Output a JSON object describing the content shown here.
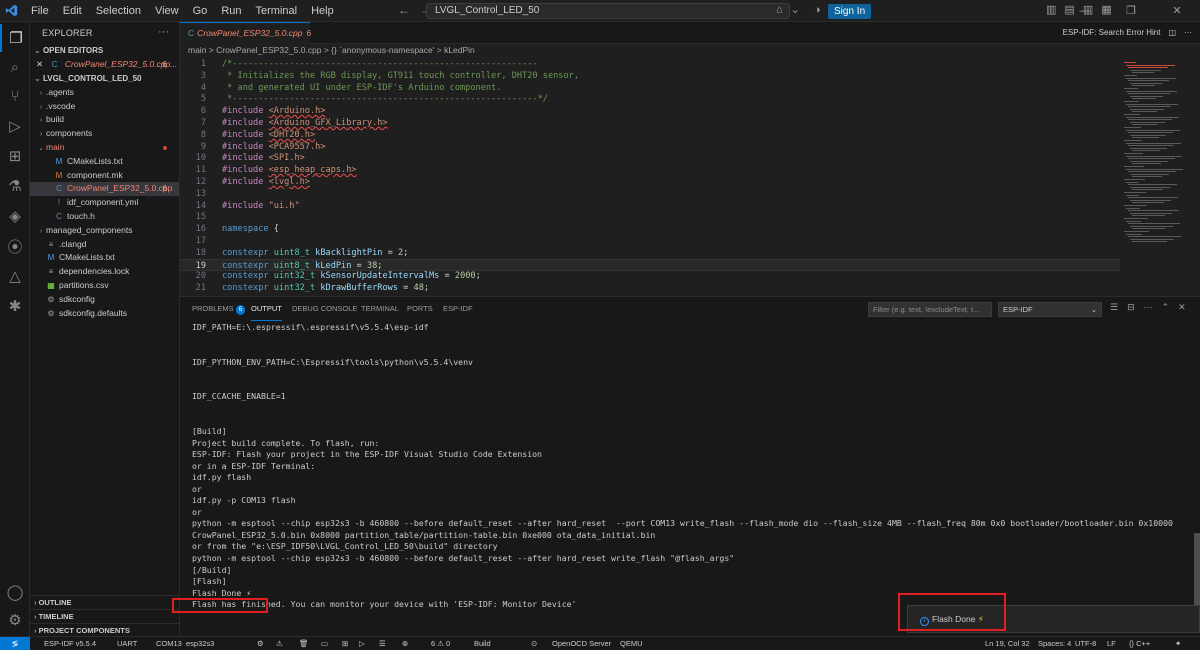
{
  "titlebar": {
    "menu": [
      "File",
      "Edit",
      "Selection",
      "View",
      "Go",
      "Run",
      "Terminal",
      "Help"
    ],
    "search": "LVGL_Control_LED_50",
    "sign_in": "Sign In"
  },
  "sidebar": {
    "title": "EXPLORER",
    "open_editors_label": "OPEN EDITORS",
    "open_editor_file": "CrowPanel_ESP32_5.0.cpp...",
    "open_editor_count": "6",
    "project_label": "LVGL_CONTROL_LED_50",
    "tree": [
      {
        "name": ".agents",
        "type": "folder"
      },
      {
        "name": ".vscode",
        "type": "folder"
      },
      {
        "name": "build",
        "type": "folder"
      },
      {
        "name": "components",
        "type": "folder"
      },
      {
        "name": "main",
        "type": "folder-open"
      },
      {
        "name": "CMakeLists.txt",
        "type": "cmake"
      },
      {
        "name": "component.mk",
        "type": "make"
      },
      {
        "name": "CrowPanel_ESP32_5.0.cpp",
        "type": "cpp",
        "count": "6"
      },
      {
        "name": "idf_component.yml",
        "type": "yml"
      },
      {
        "name": "touch.h",
        "type": "h"
      },
      {
        "name": "managed_components",
        "type": "folder"
      },
      {
        "name": ".clangd",
        "type": "file"
      },
      {
        "name": "CMakeLists.txt",
        "type": "cmake"
      },
      {
        "name": "dependencies.lock",
        "type": "file"
      },
      {
        "name": "partitions.csv",
        "type": "csv"
      },
      {
        "name": "sdkconfig",
        "type": "gear"
      },
      {
        "name": "sdkconfig.defaults",
        "type": "gear"
      }
    ],
    "bottom_sections": [
      "OUTLINE",
      "TIMELINE",
      "PROJECT COMPONENTS"
    ]
  },
  "editor": {
    "tab_label": "CrowPanel_ESP32_5.0.cpp",
    "tab_count": "6",
    "tab_right": "ESP-IDF: Search Error Hint",
    "breadcrumb": "main  >  CrowPanel_ESP32_5.0.cpp  >  {} `anonymous-namespace'  >  kLedPin",
    "current_line": 19,
    "lines": [
      {
        "n": "1",
        "text": "/*-----------------------------------------------------------"
      },
      {
        "n": "3",
        "text": " * Initializes the RGB display, GT911 touch controller, DHT20 sensor,"
      },
      {
        "n": "4",
        "text": " * and generated UI under ESP-IDF's Arduino component."
      },
      {
        "n": "5",
        "text": " *-----------------------------------------------------------*/"
      },
      {
        "n": "6",
        "text": "#include <Arduino.h>"
      },
      {
        "n": "7",
        "text": "#include <Arduino_GFX_Library.h>"
      },
      {
        "n": "8",
        "text": "#include <DHT20.h>"
      },
      {
        "n": "9",
        "text": "#include <PCA9557.h>"
      },
      {
        "n": "10",
        "text": "#include <SPI.h>"
      },
      {
        "n": "11",
        "text": "#include <esp_heap_caps.h>"
      },
      {
        "n": "12",
        "text": "#include <lvgl.h>"
      },
      {
        "n": "13",
        "text": ""
      },
      {
        "n": "14",
        "text": "#include \"ui.h\""
      },
      {
        "n": "15",
        "text": ""
      },
      {
        "n": "16",
        "text": "namespace {"
      },
      {
        "n": "17",
        "text": ""
      },
      {
        "n": "18",
        "text": "constexpr uint8_t kBacklightPin = 2;"
      },
      {
        "n": "19",
        "text": "constexpr uint8_t kLedPin = 38;"
      },
      {
        "n": "20",
        "text": "constexpr uint32_t kSensorUpdateIntervalMs = 2000;"
      },
      {
        "n": "21",
        "text": "constexpr uint32_t kDrawBufferRows = 48;"
      }
    ]
  },
  "panel": {
    "tabs": [
      "PROBLEMS",
      "OUTPUT",
      "DEBUG CONSOLE",
      "TERMINAL",
      "PORTS",
      "ESP-IDF"
    ],
    "problems_count": "6",
    "filter_placeholder": "Filter (e.g. text, !excludeText, t...",
    "channel": "ESP-IDF",
    "output": [
      "IDF_PATH=E:\\.espressif\\.espressif\\v5.5.4\\esp-idf",
      "",
      "",
      "IDF_PYTHON_ENV_PATH=C:\\Espressif\\tools\\python\\v5.5.4\\venv",
      "",
      "",
      "IDF_CCACHE_ENABLE=1",
      "",
      "",
      "[Build]",
      "Project build complete. To flash, run:",
      "ESP-IDF: Flash your project in the ESP-IDF Visual Studio Code Extension",
      "or in a ESP-IDF Terminal:",
      "idf.py flash",
      "or",
      "idf.py -p COM13 flash",
      "or",
      "python -m esptool --chip esp32s3 -b 460800 --before default_reset --after hard_reset  --port COM13 write_flash --flash_mode dio --flash_size 4MB --flash_freq 80m 0x0 bootloader/bootloader.bin 0x10000",
      "CrowPanel_ESP32_5.0.bin 0x8000 partition_table/partition-table.bin 0xe000 ota_data_initial.bin",
      "or from the \"e:\\ESP_IDF50\\LVGL_Control_LED_50\\build\" directory",
      "python -m esptool --chip esp32s3 -b 460800 --before default_reset --after hard_reset write_flash \"@flash_args\"",
      "[/Build]",
      "[Flash]",
      "Flash Done ⚡",
      "Flash has finished. You can monitor your device with 'ESP-IDF: Monitor Device'"
    ]
  },
  "toast": {
    "message": "Flash Done",
    "icon": "info-icon"
  },
  "statusbar": {
    "left": [
      "ESP-IDF v5.5.4",
      "UART",
      "COM13",
      "esp32s3",
      "⚙",
      "⚠",
      "🗑",
      "▭",
      "⊞",
      "▷",
      "☰",
      "⊗",
      "6 ⚠ 0",
      "Build",
      "⊙",
      "OpenOCD Server",
      "QEMU"
    ],
    "right": [
      "Ln 19, Col 32",
      "Spaces: 4",
      "UTF-8",
      "LF",
      "{} C++",
      "✦"
    ]
  }
}
